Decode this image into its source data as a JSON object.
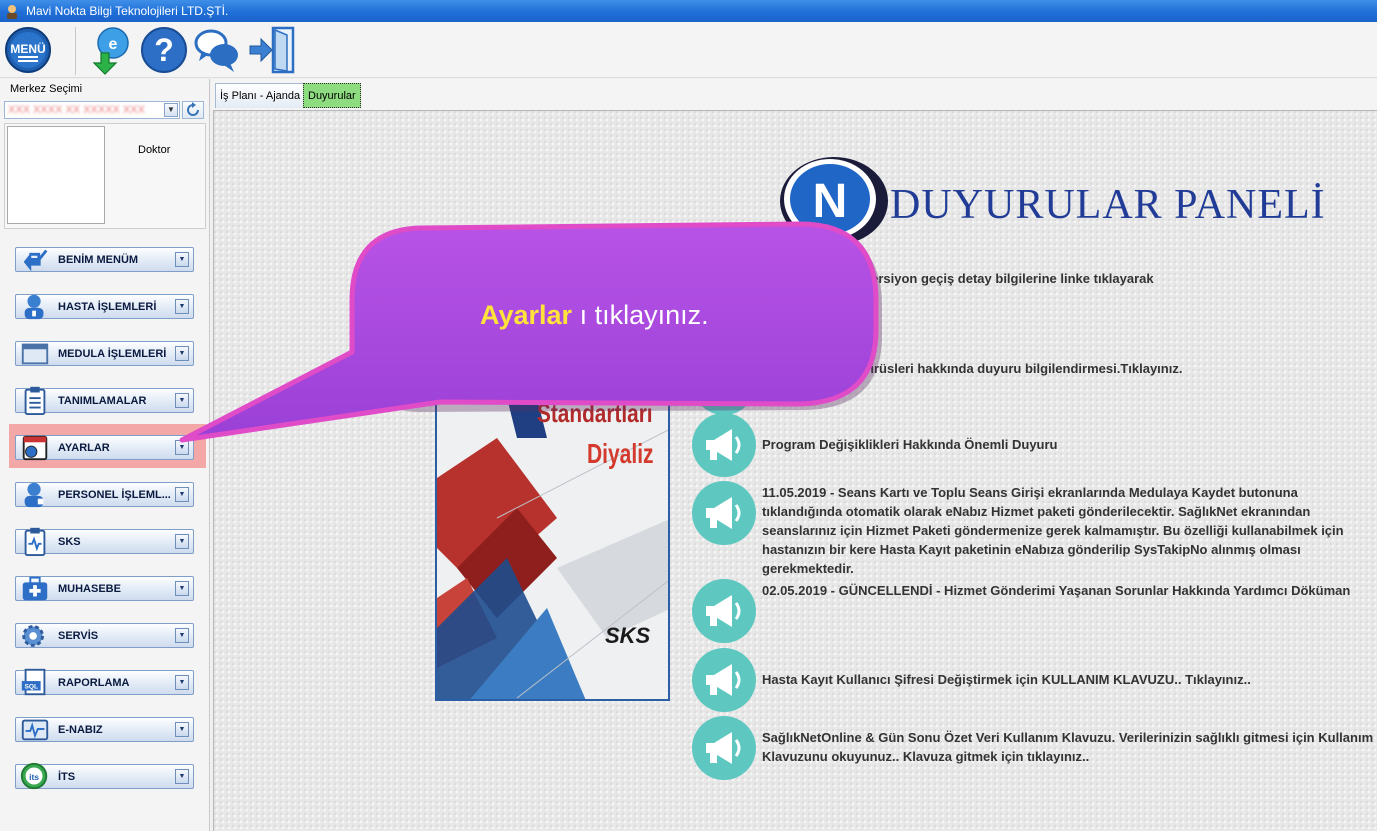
{
  "window": {
    "title": "Mavi Nokta Bilgi Teknolojileri LTD.ŞTİ."
  },
  "toolbar": {
    "buttons": [
      {
        "name": "menu-icon",
        "label": "MENÜ"
      },
      {
        "name": "download-update-icon"
      },
      {
        "name": "help-icon"
      },
      {
        "name": "chat-icon"
      },
      {
        "name": "exit-icon"
      }
    ]
  },
  "left_panel": {
    "merkez_label": "Merkez Seçimi",
    "merkez_value": "XXX XXXX XX XXXXX XXX",
    "doctor_label": "Doktor",
    "menu": [
      {
        "label": "BENİM MENÜM",
        "icon": "my-menu-icon"
      },
      {
        "label": "HASTA İŞLEMLERİ",
        "icon": "patient-icon"
      },
      {
        "label": "MEDULA İŞLEMLERİ",
        "icon": "medula-window-icon"
      },
      {
        "label": "TANIMLAMALAR",
        "icon": "clipboard-list-icon"
      },
      {
        "label": "AYARLAR",
        "icon": "settings-calendar-icon",
        "highlighted": true
      },
      {
        "label": "PERSONEL İŞLEML...",
        "icon": "staff-icon"
      },
      {
        "label": "SKS",
        "icon": "clipboard-pulse-icon"
      },
      {
        "label": "MUHASEBE",
        "icon": "medical-bag-icon"
      },
      {
        "label": "SERVİS",
        "icon": "gear-icon"
      },
      {
        "label": "RAPORLAMA",
        "icon": "sql-report-icon"
      },
      {
        "label": "E-NABIZ",
        "icon": "pulse-monitor-icon"
      },
      {
        "label": "İTS",
        "icon": "its-icon"
      }
    ]
  },
  "tabs": [
    {
      "label": "İş Planı - Ajanda",
      "active": false
    },
    {
      "label": "Duyurular",
      "active": true
    }
  ],
  "content": {
    "panel_title": "DUYURULAR PANELİ",
    "book": {
      "title_top": "Standartları",
      "title_bottom": "Diyaliz",
      "brand": "SKS"
    },
    "announcements": [
      {
        "text": "yönetim sistemi versiyon geçiş detay bilgilerine linke tıklayarak"
      },
      {
        "text": "EMLİ- Şifreleme virüsleri hakkında duyuru bilgilendirmesi.Tıklayınız."
      },
      {
        "text": "Program Değişiklikleri Hakkında Önemli Duyuru"
      },
      {
        "text": "11.05.2019 - Seans Kartı ve Toplu Seans Girişi ekranlarında Medulaya Kaydet butonuna tıklandığında otomatik olarak eNabız Hizmet paketi gönderilecektir. SağlıkNet ekranından seanslarınız için Hizmet Paketi göndermenize gerek kalmamıştır. Bu özelliği kullanabilmek için hastanızın bir kere Hasta Kayıt paketinin eNabıza gönderilip SysTakipNo alınmış olması gerekmektedir."
      },
      {
        "text": "02.05.2019 - GÜNCELLENDİ - Hizmet Gönderimi Yaşanan Sorunlar Hakkında Yardımcı Döküman"
      },
      {
        "text": "Hasta Kayıt Kullanıcı Şifresi Değiştirmek için KULLANIM KLAVUZU.. Tıklayınız.."
      },
      {
        "text": "SağlıkNetOnline & Gün Sonu Özet Veri Kullanım Klavuzu. Verilerinizin sağlıklı gitmesi için Kullanım Klavuzunu okuyunuz.. Klavuza gitmek için tıklayınız.."
      }
    ]
  },
  "callout": {
    "keyword": "Ayarlar",
    "rest": " ı tıklayınız."
  },
  "colors": {
    "title_blue": "#213c96",
    "callout_purple": "#a94be0",
    "callout_border": "#e04bc8",
    "highlight": "#f4a7a7",
    "icon_teal": "#5ec8c0"
  }
}
